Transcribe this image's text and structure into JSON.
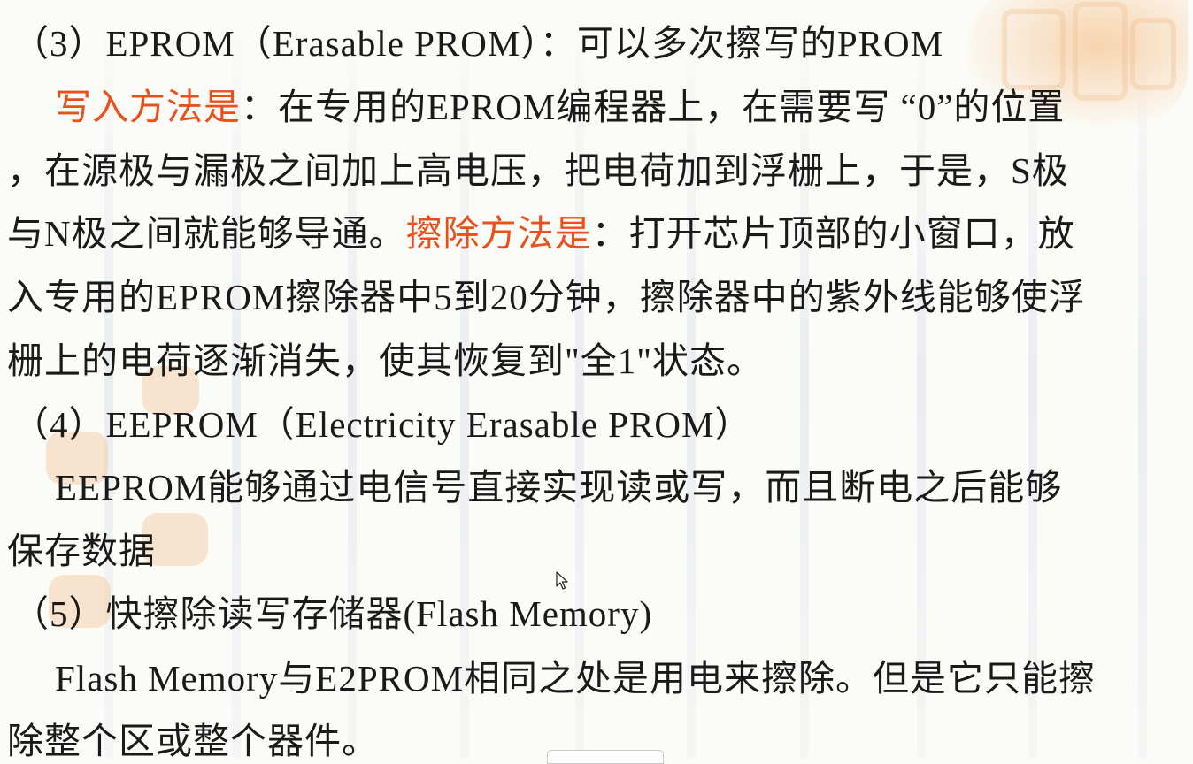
{
  "slide": {
    "lines": [
      {
        "parts": [
          "（3）EPROM（Erasable PROM）：可以多次擦写的PROM"
        ]
      },
      {
        "parts": [
          "写入方法是",
          "：在专用的EPROM编程器上，在需要写 “0”的位置"
        ]
      },
      {
        "parts": [
          "，在源极与漏极之间加上高电压，把电荷加到浮栅上，于是，S极"
        ]
      },
      {
        "parts": [
          "与N极之间就能够导通。",
          "擦除方法是",
          "：打开芯片顶部的小窗口，放"
        ]
      },
      {
        "parts": [
          "入专用的EPROM擦除器中5到20分钟，擦除器中的紫外线能够使浮"
        ]
      },
      {
        "parts": [
          "栅上的电荷逐渐消失，使其恢复到\"全1\"状态。"
        ]
      },
      {
        "parts": [
          "（4）EEPROM（Electricity Erasable PROM）"
        ]
      },
      {
        "parts": [
          "EEPROM能够通过电信号直接实现读或写，而且断电之后能够"
        ]
      },
      {
        "parts": [
          "保存数据"
        ]
      },
      {
        "parts": [
          "（5）快擦除读写存储器(Flash Memory)"
        ]
      },
      {
        "parts": [
          "Flash Memory与E2PROM相同之处是用电来擦除。但是它只能擦"
        ]
      },
      {
        "parts": [
          "除整个区或整个器件。"
        ]
      }
    ]
  },
  "colors": {
    "text": "#1a1a1a",
    "highlight": "#e8501c",
    "background": "#fbfbf7"
  },
  "icons": {
    "cursor": "mouse-pointer-icon"
  }
}
